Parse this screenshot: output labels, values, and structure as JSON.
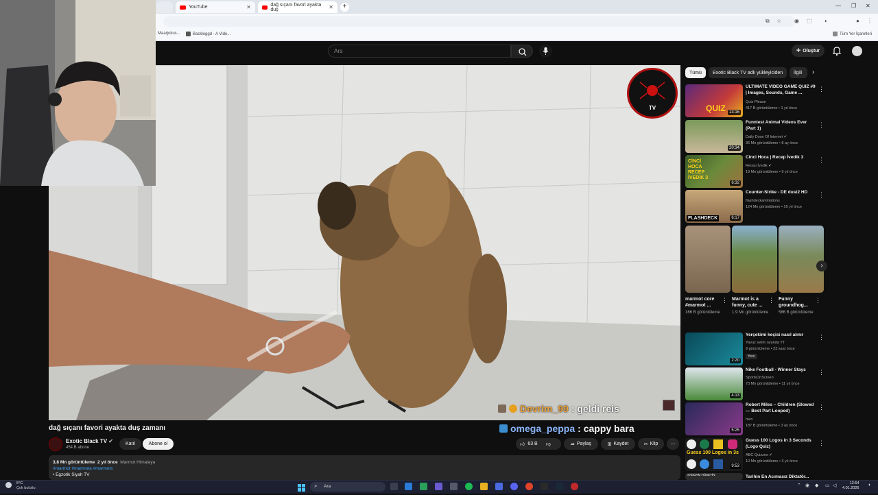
{
  "browser": {
    "tabs": [
      {
        "label": ""
      },
      {
        "label": "YouTube"
      },
      {
        "label": "dağ sıçanı favori ayakta duş"
      }
    ],
    "bookmarks": [
      {
        "label": "Maarjokus..."
      },
      {
        "label": "Backloggd - A Vide..."
      }
    ],
    "all_bookmarks_label": "Tüm Yer İşaretleri",
    "window_controls": [
      "—",
      "❐",
      "✕"
    ]
  },
  "youtube": {
    "search_placeholder": "Ara",
    "create_label": "Oluştur"
  },
  "video": {
    "channel_logo_text": "Exotic Black TV",
    "chat": [
      {
        "user": "Devrim_99",
        "message": ": geldi reis"
      },
      {
        "user": "omega_peppa",
        "message": ": cappy bara"
      }
    ],
    "title": "dağ sıçanı favori ayakta duş zamanı",
    "channel_name": "Exotic Black TV",
    "subscribers": "454 B abone",
    "join_label": "Katıl",
    "subscribe_label": "Abone ol",
    "like_count": "63 B",
    "share_label": "Paylaş",
    "save_label": "Kaydet",
    "clip_label": "Klip",
    "views": "3,8 Mn görüntüleme",
    "age": "2 yıl önce",
    "location": "Marmot Himalaya",
    "hashtags": "#marmot #marmota #marmots",
    "desc_line": "• Egzotik Siyah TV"
  },
  "sidebar": {
    "chips": [
      {
        "label": "Tümü"
      },
      {
        "label": "Exotic Black TV adlı yükleyiciden"
      },
      {
        "label": "İlgili"
      }
    ],
    "videos_top": [
      {
        "title": "ULTIMATE VIDEO GAME QUIZ #9 | Images, Sounds, Game ...",
        "channel": "Quiz Please",
        "meta": "417 B görüntüleme • 1 yıl önce",
        "duration": "13:16",
        "thumb_text": "QUIZ"
      },
      {
        "title": "Funniest Animal Videos Ever (Part 1)",
        "channel": "Daily Dose Of Internet",
        "meta": "36 Mn görüntüleme • 8 ay önce",
        "duration": "20:34"
      },
      {
        "title": "Cinci Hoca | Recep İvedik 3",
        "channel": "Recep İvedik",
        "meta": "19 Mn görüntüleme • 9 yıl önce",
        "duration": "6:32",
        "thumb_text": "CİNCİ HOCA RECEP İVEDİK 3"
      },
      {
        "title": "Counter-Strike - DE dust2 HD",
        "channel": "flashdeckanimations",
        "meta": "124 Mn görüntüleme • 16 yıl önce",
        "duration": "6:17",
        "thumb_text": "FLASHDECK"
      }
    ],
    "shorts": [
      {
        "title": "marmot core #marmot ...",
        "views": "166 B görüntüleme"
      },
      {
        "title": "Marmot is a funny, cute ...",
        "views": "1,9 Mn görüntüleme"
      },
      {
        "title": "Funny groundhog...",
        "views": "586 B görüntüleme"
      }
    ],
    "videos_bottom": [
      {
        "title": "Yerçekimi keçisi nasıl alınır",
        "channel": "Yavuz selim oyunda YT",
        "meta": "9 görüntüleme • 23 saat önce",
        "badge": "Yeni",
        "duration": "2:20"
      },
      {
        "title": "Nike Football - Winner Stays",
        "channel": "SportsOnScreen",
        "meta": "73 Mn görüntüleme • 11 yıl önce",
        "duration": "4:13"
      },
      {
        "title": "Robert Miles – Children (Slowed — Best Part Looped)",
        "channel": "hien",
        "meta": "187 B görüntüleme • 3 ay önce",
        "duration": "5:25"
      },
      {
        "title": "Guess 100 Logos in 3 Seconds (Logo Quiz)",
        "channel": "ABC Quizzes",
        "meta": "10 Mn görüntüleme • 3 yıl önce",
        "duration": "9:53",
        "thumb_text": "Guess 100 Logos in 3s"
      },
      {
        "title": "Tarihin En Acımasız Diktatör...",
        "channel": "",
        "meta": "",
        "duration": "",
        "thumb_text": "SADDAM HÜSEYİN"
      }
    ]
  },
  "taskbar": {
    "weather_temp": "5°C",
    "weather_desc": "Çok bulutlu",
    "search_placeholder": "Ara",
    "time": "12:54",
    "date": "4.01.2026"
  },
  "colors": {
    "youtube_red": "#ff0000",
    "yt_bg": "#0f0f0f",
    "chip_bg": "#272727",
    "chat_user1": "#e9a03a",
    "chat_user2": "#8ab4f8"
  }
}
